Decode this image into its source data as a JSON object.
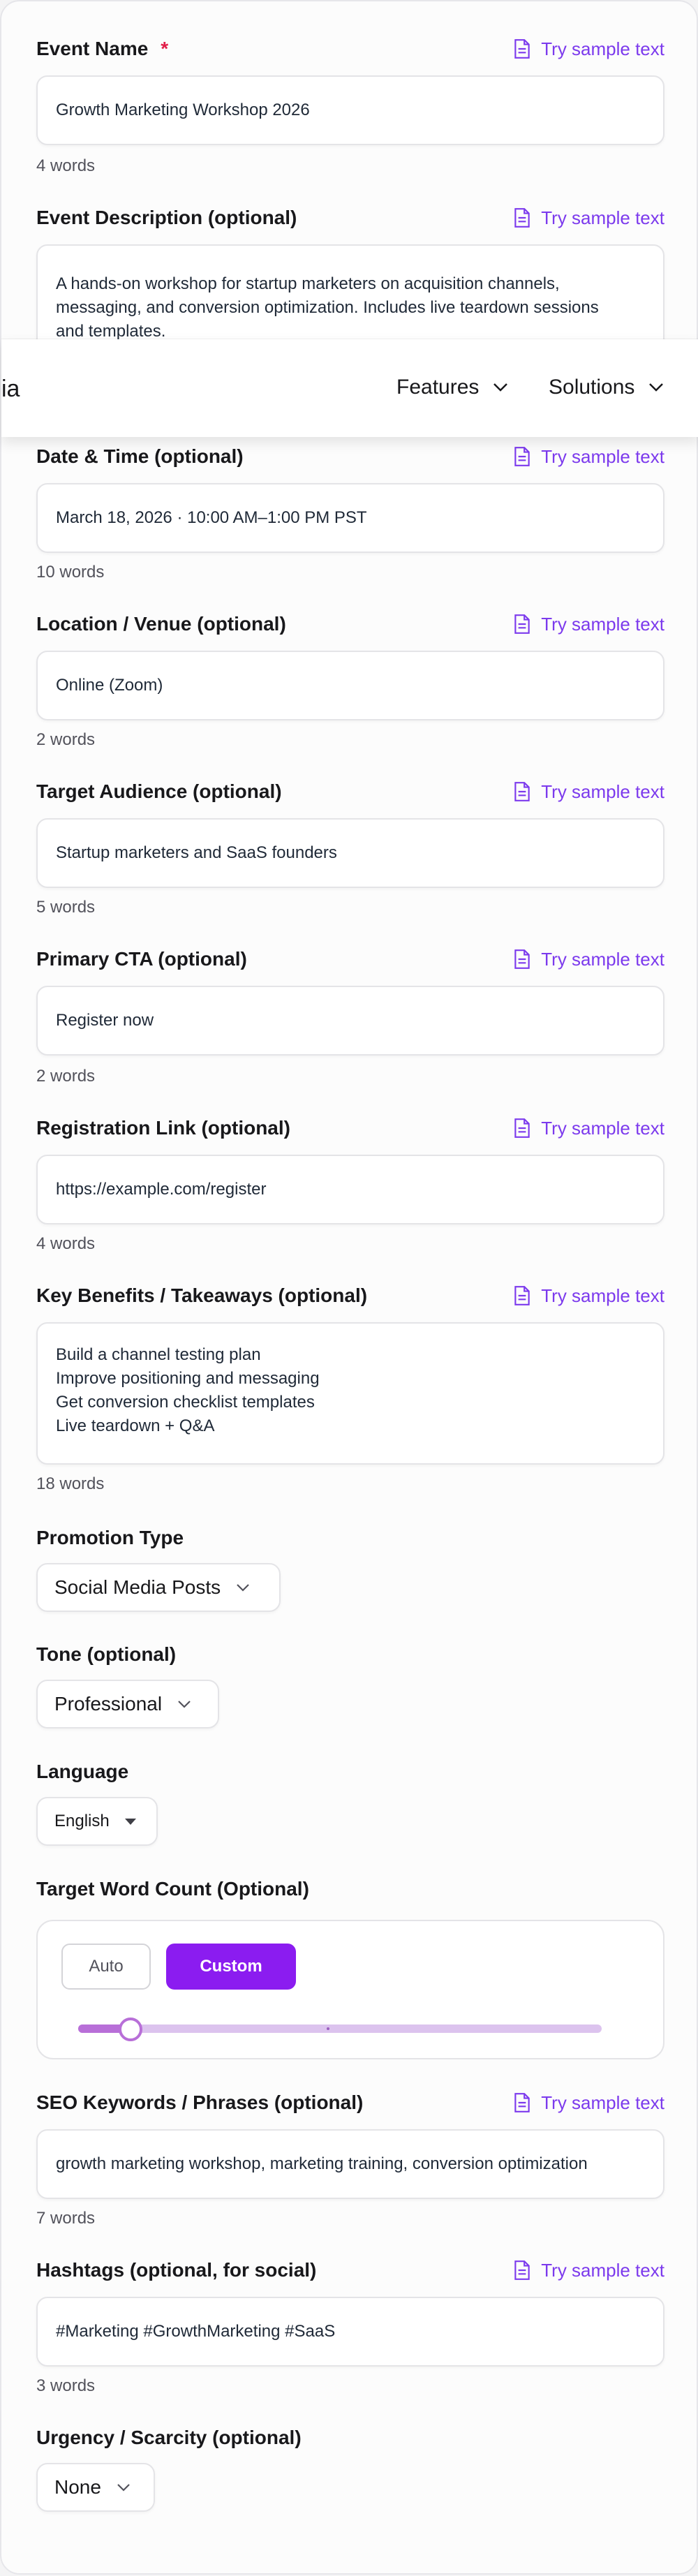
{
  "sample_label": "Try sample text",
  "fields": {
    "event_name": {
      "label": "Event Name",
      "required_mark": "*",
      "value": "Growth Marketing Workshop 2026",
      "word_count": "4 words"
    },
    "event_description": {
      "label": "Event Description (optional)",
      "value": "A hands-on workshop for startup marketers on acquisition channels,\nmessaging, and conversion optimization. Includes live teardown sessions\nand templates."
    },
    "date_time": {
      "label": "Date & Time (optional)",
      "value": "March 18, 2026 · 10:00 AM–1:00 PM PST",
      "word_count": "10 words"
    },
    "location": {
      "label": "Location / Venue (optional)",
      "value": "Online (Zoom)",
      "word_count": "2 words"
    },
    "audience": {
      "label": "Target Audience (optional)",
      "value": "Startup marketers and SaaS founders",
      "word_count": "5 words"
    },
    "cta": {
      "label": "Primary CTA (optional)",
      "value": "Register now",
      "word_count": "2 words"
    },
    "reg_link": {
      "label": "Registration Link (optional)",
      "value": "https://example.com/register",
      "word_count": "4 words"
    },
    "benefits": {
      "label": "Key Benefits / Takeaways (optional)",
      "value": "Build a channel testing plan\nImprove positioning and messaging\nGet conversion checklist templates\nLive teardown + Q&A",
      "word_count": "18 words"
    },
    "seo": {
      "label": "SEO Keywords / Phrases (optional)",
      "value": "growth marketing workshop, marketing training, conversion optimization",
      "word_count": "7 words"
    },
    "hashtags": {
      "label": "Hashtags (optional, for social)",
      "value": "#Marketing #GrowthMarketing #SaaS",
      "word_count": "3 words"
    }
  },
  "selects": {
    "promotion": {
      "label": "Promotion Type",
      "value": "Social Media Posts"
    },
    "tone": {
      "label": "Tone (optional)",
      "value": "Professional"
    },
    "language": {
      "label": "Language",
      "value": "English"
    },
    "urgency": {
      "label": "Urgency / Scarcity (optional)",
      "value": "None"
    }
  },
  "word_count_control": {
    "label": "Target Word Count (Optional)",
    "auto_label": "Auto",
    "custom_label": "Custom",
    "selected": "Custom",
    "slider_fraction": 0.1
  },
  "navbar": {
    "logo_partial": "ia",
    "items": [
      "Features",
      "Solutions"
    ]
  },
  "colors": {
    "accent": "#8b1cf0",
    "link": "#7c3aed",
    "required": "#e11d48"
  }
}
